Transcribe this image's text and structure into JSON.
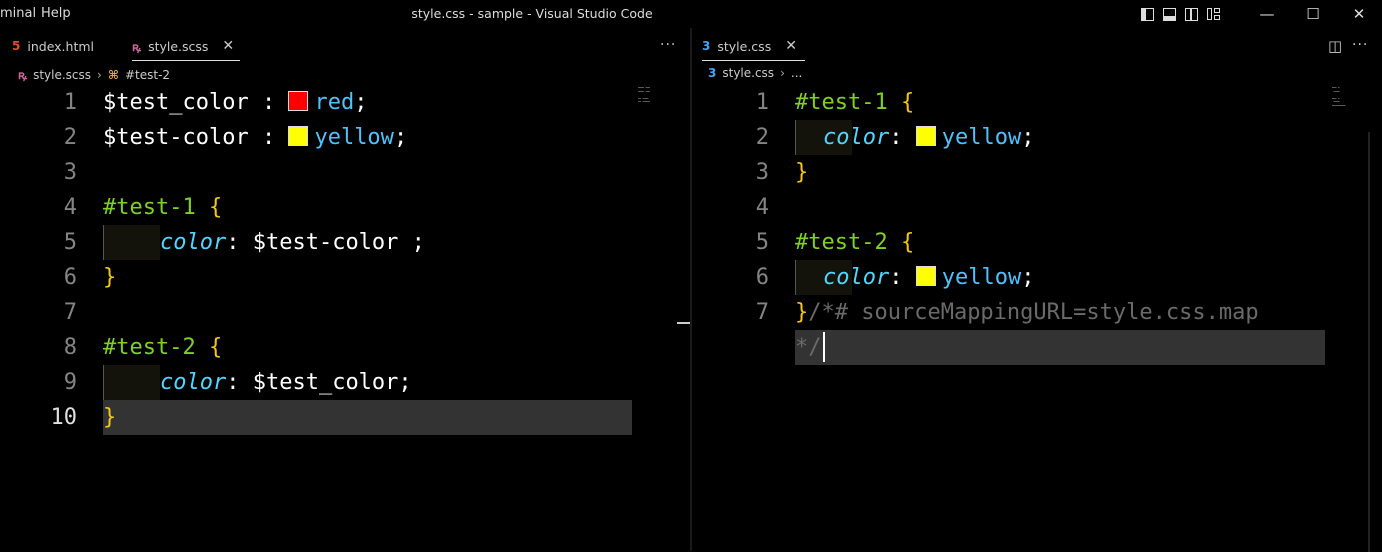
{
  "menu": {
    "terminal": "minal",
    "help": "Help"
  },
  "window_title": "style.css - sample - Visual Studio Code",
  "controls": {
    "minimize": "—",
    "maximize": "☐",
    "close": "✕"
  },
  "left": {
    "tabs": [
      {
        "icon": "5",
        "label": "index.html",
        "color": "#e44d26"
      },
      {
        "icon": "ꝶ",
        "label": "style.scss",
        "close": "✕",
        "color": "#cd6799"
      }
    ],
    "more": "···",
    "breadcrumb": {
      "file": "style.scss",
      "symbol": "#test-2"
    },
    "lines": [
      {
        "n": "1",
        "tokens": [
          {
            "c": "var",
            "t": "$test_color"
          },
          {
            "c": "pun",
            "t": " : "
          },
          {
            "c": "swatch",
            "color": "#ff0000"
          },
          {
            "c": "val",
            "t": "red"
          },
          {
            "c": "pun",
            "t": ";"
          }
        ]
      },
      {
        "n": "2",
        "tokens": [
          {
            "c": "var",
            "t": "$test-color"
          },
          {
            "c": "pun",
            "t": " : "
          },
          {
            "c": "swatch",
            "color": "#ffff00"
          },
          {
            "c": "val",
            "t": "yellow"
          },
          {
            "c": "pun",
            "t": ";"
          }
        ]
      },
      {
        "n": "3",
        "tokens": []
      },
      {
        "n": "4",
        "tokens": [
          {
            "c": "sel",
            "t": "#test-1"
          },
          {
            "c": "pun",
            "t": " "
          },
          {
            "c": "br",
            "t": "{"
          }
        ]
      },
      {
        "n": "5",
        "indent": true,
        "tokens": [
          {
            "c": "prop",
            "t": "color"
          },
          {
            "c": "pun",
            "t": ": $test-color ;"
          }
        ]
      },
      {
        "n": "6",
        "tokens": [
          {
            "c": "br",
            "t": "}"
          }
        ]
      },
      {
        "n": "7",
        "tokens": []
      },
      {
        "n": "8",
        "tokens": [
          {
            "c": "sel",
            "t": "#test-2"
          },
          {
            "c": "pun",
            "t": " "
          },
          {
            "c": "br",
            "t": "{"
          }
        ]
      },
      {
        "n": "9",
        "indent": true,
        "tokens": [
          {
            "c": "prop",
            "t": "color"
          },
          {
            "c": "pun",
            "t": ": $test_color;"
          }
        ]
      },
      {
        "n": "10",
        "current": true,
        "tokens": [
          {
            "c": "br",
            "t": "}"
          }
        ]
      }
    ]
  },
  "right": {
    "tabs": [
      {
        "icon": "3",
        "label": "style.css",
        "close": "✕",
        "color": "#42a5f5"
      }
    ],
    "more": "···",
    "split": "◫",
    "breadcrumb": {
      "file": "style.css",
      "symbol": "..."
    },
    "lines": [
      {
        "n": "1",
        "tokens": [
          {
            "c": "sel",
            "t": "#test-1"
          },
          {
            "c": "pun",
            "t": " "
          },
          {
            "c": "br",
            "t": "{"
          }
        ]
      },
      {
        "n": "2",
        "indent": true,
        "tokens": [
          {
            "c": "prop",
            "t": "color"
          },
          {
            "c": "pun",
            "t": ": "
          },
          {
            "c": "swatch",
            "color": "#ffff00"
          },
          {
            "c": "val",
            "t": "yellow"
          },
          {
            "c": "pun",
            "t": ";"
          }
        ]
      },
      {
        "n": "3",
        "tokens": [
          {
            "c": "br",
            "t": "}"
          }
        ]
      },
      {
        "n": "4",
        "tokens": []
      },
      {
        "n": "5",
        "tokens": [
          {
            "c": "sel",
            "t": "#test-2"
          },
          {
            "c": "pun",
            "t": " "
          },
          {
            "c": "br",
            "t": "{"
          }
        ]
      },
      {
        "n": "6",
        "indent": true,
        "tokens": [
          {
            "c": "prop",
            "t": "color"
          },
          {
            "c": "pun",
            "t": ": "
          },
          {
            "c": "swatch",
            "color": "#ffff00"
          },
          {
            "c": "val",
            "t": "yellow"
          },
          {
            "c": "pun",
            "t": ";"
          }
        ]
      },
      {
        "n": "7",
        "tokens": [
          {
            "c": "br",
            "t": "}"
          },
          {
            "c": "cmt",
            "t": "/*# sourceMappingURL=style.css.map"
          }
        ]
      },
      {
        "n": "",
        "current": true,
        "tokens": [
          {
            "c": "cmt",
            "t": "*/"
          }
        ]
      }
    ]
  }
}
